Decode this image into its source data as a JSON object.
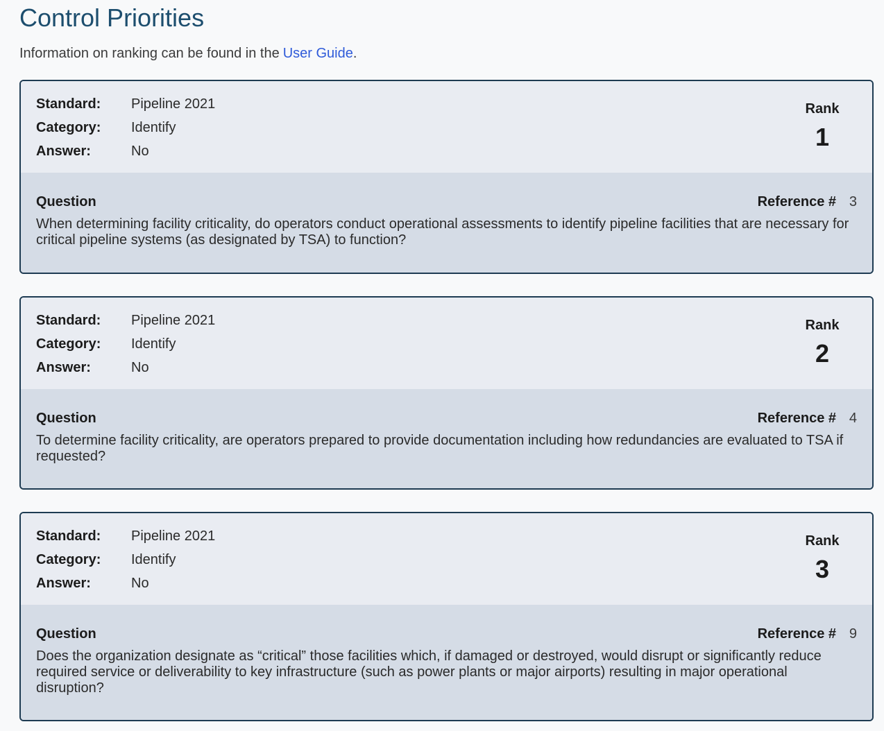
{
  "header": {
    "title": "Control Priorities",
    "intro_text": "Information on ranking can be found in the",
    "guide_link": "User Guide",
    "intro_end": "."
  },
  "labels": {
    "standard": "Standard:",
    "category": "Category:",
    "answer": "Answer:",
    "rank": "Rank",
    "question": "Question",
    "reference": "Reference #"
  },
  "cards": [
    {
      "standard": "Pipeline 2021",
      "category": "Identify",
      "answer": "No",
      "rank": "1",
      "reference": "3",
      "question": "When determining facility criticality, do operators conduct operational assessments to identify pipeline facilities that are necessary for critical pipeline systems (as designated by TSA) to function?"
    },
    {
      "standard": "Pipeline 2021",
      "category": "Identify",
      "answer": "No",
      "rank": "2",
      "reference": "4",
      "question": "To determine facility criticality, are operators prepared to provide documentation including how redundancies are evaluated to TSA if requested?"
    },
    {
      "standard": "Pipeline 2021",
      "category": "Identify",
      "answer": "No",
      "rank": "3",
      "reference": "9",
      "question": "Does the organization designate as “critical” those facilities which, if damaged or destroyed, would disrupt or significantly reduce required service or deliverability to key infrastructure (such as power plants or major airports) resulting in major operational disruption?"
    }
  ]
}
